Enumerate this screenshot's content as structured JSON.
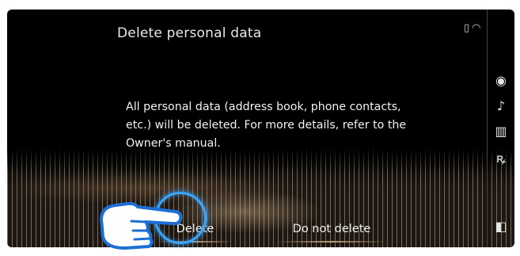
{
  "screen": {
    "title": "Delete personal data",
    "message": "All personal data (address book, phone contacts, etc.) will be deleted. For more details, refer to the Owner's manual."
  },
  "status_bar": {
    "icons": [
      "phone-disconnected-icon",
      "wifi-icon"
    ],
    "phone_glyph": "▯",
    "wifi_glyph": "◠"
  },
  "side_bar": {
    "items": [
      {
        "name": "navigation-icon",
        "glyph": "◉"
      },
      {
        "name": "music-note-icon",
        "glyph": "♪"
      },
      {
        "name": "equalizer-icon",
        "glyph": "▥"
      },
      {
        "name": "climate-icon",
        "glyph": "ꝶ"
      },
      {
        "name": "display-icon",
        "glyph": "◧"
      }
    ]
  },
  "buttons": {
    "delete_label": "Delete",
    "keep_label": "Do not delete"
  },
  "colors": {
    "background": "#000000",
    "text": "#f2f2f2",
    "focus_ring": "#3aa6ff",
    "accent_wave": "#d2aa78"
  }
}
